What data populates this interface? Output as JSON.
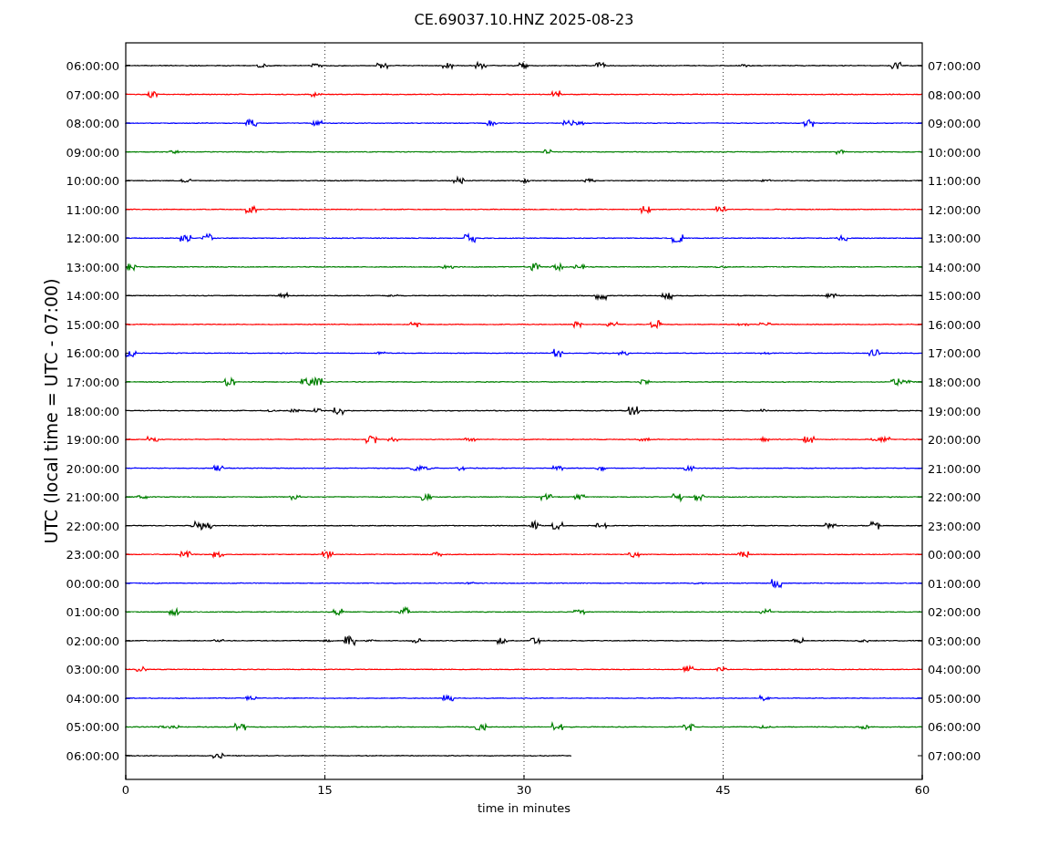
{
  "title": "CE.69037.10.HNZ 2025-08-23",
  "ylabel": "UTC (local time = UTC - 07:00)",
  "xlabel": "time in minutes",
  "xticks": [
    "0",
    "15",
    "30",
    "45",
    "60"
  ],
  "traces": [
    {
      "left": "06:00:00",
      "right": "07:00:00",
      "color": "#000000",
      "level": 1
    },
    {
      "left": "07:00:00",
      "right": "08:00:00",
      "color": "#ff0000",
      "level": 1
    },
    {
      "left": "08:00:00",
      "right": "09:00:00",
      "color": "#0000ff",
      "level": 1
    },
    {
      "left": "09:00:00",
      "right": "10:00:00",
      "color": "#008000",
      "level": 1
    },
    {
      "left": "10:00:00",
      "right": "11:00:00",
      "color": "#000000",
      "level": 1
    },
    {
      "left": "11:00:00",
      "right": "12:00:00",
      "color": "#ff0000",
      "level": 1
    },
    {
      "left": "12:00:00",
      "right": "13:00:00",
      "color": "#0000ff",
      "level": 1
    },
    {
      "left": "13:00:00",
      "right": "14:00:00",
      "color": "#008000",
      "level": 1
    },
    {
      "left": "14:00:00",
      "right": "15:00:00",
      "color": "#000000",
      "level": 1
    },
    {
      "left": "15:00:00",
      "right": "16:00:00",
      "color": "#ff0000",
      "level": 1
    },
    {
      "left": "16:00:00",
      "right": "17:00:00",
      "color": "#0000ff",
      "level": 1
    },
    {
      "left": "17:00:00",
      "right": "18:00:00",
      "color": "#008000",
      "level": 1
    },
    {
      "left": "18:00:00",
      "right": "19:00:00",
      "color": "#000000",
      "level": 1
    },
    {
      "left": "19:00:00",
      "right": "20:00:00",
      "color": "#ff0000",
      "level": 1
    },
    {
      "left": "20:00:00",
      "right": "21:00:00",
      "color": "#0000ff",
      "level": 1
    },
    {
      "left": "21:00:00",
      "right": "22:00:00",
      "color": "#008000",
      "level": 1
    },
    {
      "left": "22:00:00",
      "right": "23:00:00",
      "color": "#000000",
      "level": 1
    },
    {
      "left": "23:00:00",
      "right": "00:00:00",
      "color": "#ff0000",
      "level": 1
    },
    {
      "left": "00:00:00",
      "right": "01:00:00",
      "color": "#0000ff",
      "level": 1
    },
    {
      "left": "01:00:00",
      "right": "02:00:00",
      "color": "#008000",
      "level": 1
    },
    {
      "left": "02:00:00",
      "right": "03:00:00",
      "color": "#000000",
      "level": 1
    },
    {
      "left": "03:00:00",
      "right": "04:00:00",
      "color": "#ff0000",
      "level": 1
    },
    {
      "left": "04:00:00",
      "right": "05:00:00",
      "color": "#0000ff",
      "level": 1
    },
    {
      "left": "05:00:00",
      "right": "06:00:00",
      "color": "#008000",
      "level": 1
    },
    {
      "left": "06:00:00",
      "right": "07:00:00",
      "color": "#000000",
      "level": 0.56
    }
  ]
}
